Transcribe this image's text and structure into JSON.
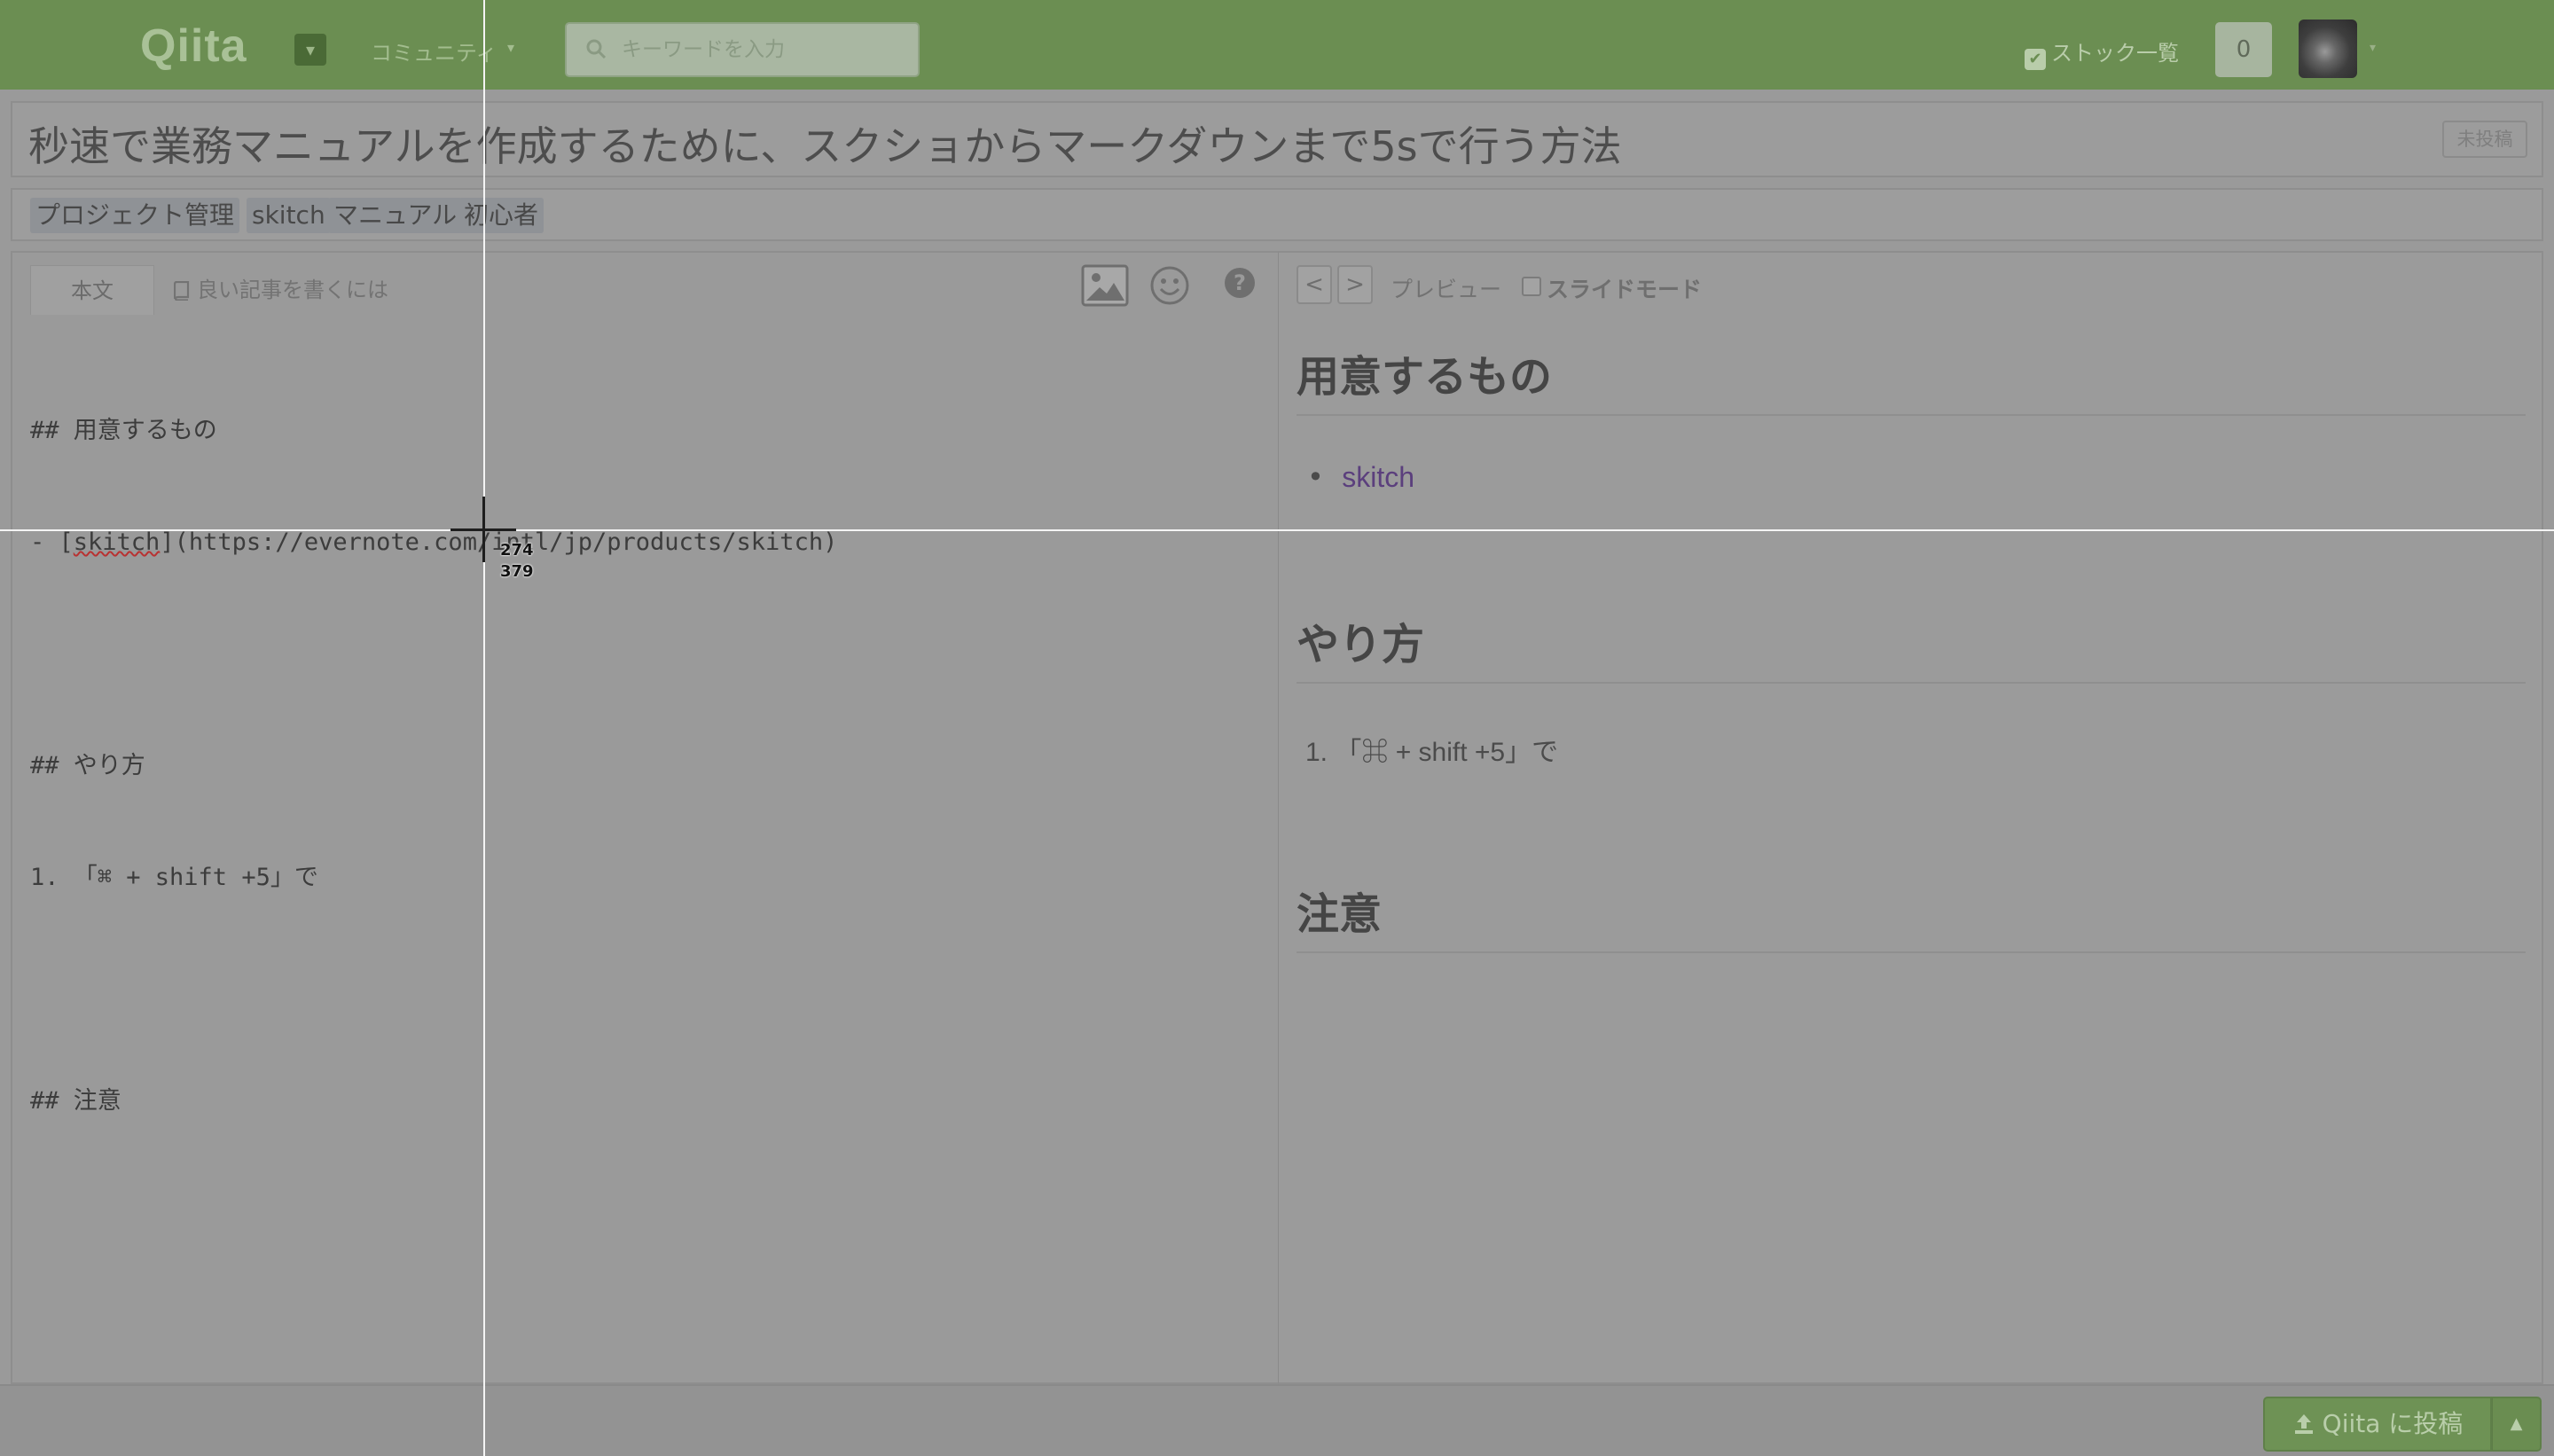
{
  "header": {
    "logo": "Qiita",
    "community_label": "コミュニティ",
    "search": {
      "placeholder": "キーワードを入力",
      "value": ""
    },
    "stock_label": "ストック一覧",
    "notification_count": "0"
  },
  "article": {
    "title": "秒速で業務マニュアルを作成するために、スクショからマークダウンまで5sで行う方法",
    "status_badge": "未投稿",
    "tags": [
      "プロジェクト管理",
      "skitch",
      "マニュアル",
      "初心者"
    ]
  },
  "editor": {
    "tab_body": "本文",
    "tab_guide": "良い記事を書くには",
    "lines": {
      "l1": "## 用意するもの",
      "l2_prefix": "- [",
      "l2_link": "skitch",
      "l2_suffix": "](https://evernote.com/intl/jp/products/skitch)",
      "l3": "",
      "l4": "## やり方",
      "l5": "1. 「⌘ + shift +5」で",
      "l6": "",
      "l7": "## 注意"
    }
  },
  "preview": {
    "prev_label": "<",
    "next_label": ">",
    "label": "プレビュー",
    "slide_mode_label": "スライドモード",
    "slide_mode_checked": false,
    "h1": "用意するもの",
    "bullet_link": "skitch",
    "h2": "やり方",
    "ol_item": "「⌘ + shift +5」で",
    "h3": "注意"
  },
  "footer": {
    "post_button": "Qiita に投稿"
  },
  "crosshair": {
    "x_readout": "274",
    "y_readout": "379"
  },
  "colors": {
    "header_bg": "#6b8e52",
    "post_button_bg": "#6e9255",
    "link_color": "#5b3f7d"
  },
  "icons": [
    "caret-down-icon",
    "search-icon",
    "check-icon",
    "image-icon",
    "emoji-icon",
    "help-icon",
    "book-icon",
    "upload-icon"
  ]
}
